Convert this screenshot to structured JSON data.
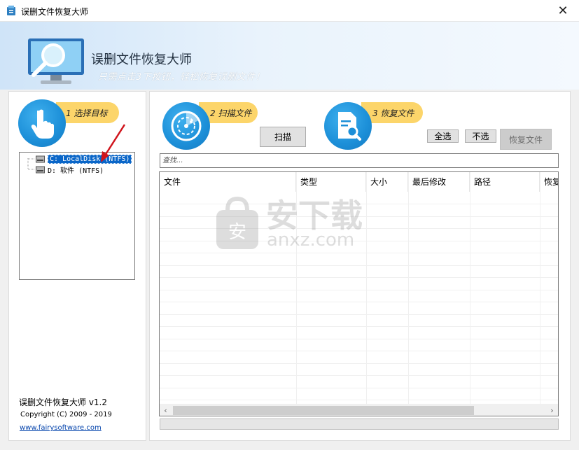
{
  "window": {
    "title": "误删文件恢复大师",
    "close_glyph": "✕"
  },
  "banner": {
    "title": "误删文件恢复大师",
    "subtitle": "只需点击3下按钮，轻松恢复误删文件！"
  },
  "steps": [
    {
      "label": "1 选择目标",
      "icon": "pointing-hand-icon"
    },
    {
      "label": "2 扫描文件",
      "icon": "radar-icon"
    },
    {
      "label": "3 恢复文件",
      "icon": "document-search-icon"
    }
  ],
  "drive_tree": {
    "items": [
      {
        "label": "C: LocalDisk (NTFS)",
        "selected": true
      },
      {
        "label": "D: 软件 (NTFS)",
        "selected": false
      }
    ]
  },
  "buttons": {
    "scan": "扫描",
    "select_all": "全选",
    "select_none": "不选",
    "recover": "恢复文件"
  },
  "search": {
    "placeholder": "查找..."
  },
  "file_table": {
    "columns": [
      "文件",
      "类型",
      "大小",
      "最后修改",
      "路径",
      "恢复"
    ],
    "rows": []
  },
  "footer": {
    "app_version": "误删文件恢复大师 v1.2",
    "copyright": "Copyright (C) 2009 - 2019",
    "website": "www.fairysoftware.com"
  },
  "watermark": {
    "text_cn": "安下载",
    "text_en": "anxz.com"
  },
  "colors": {
    "accent_blue": "#1c8fd8",
    "step_pill": "#fcd56a",
    "selection": "#0a66c8",
    "arrow": "#d0141c"
  }
}
